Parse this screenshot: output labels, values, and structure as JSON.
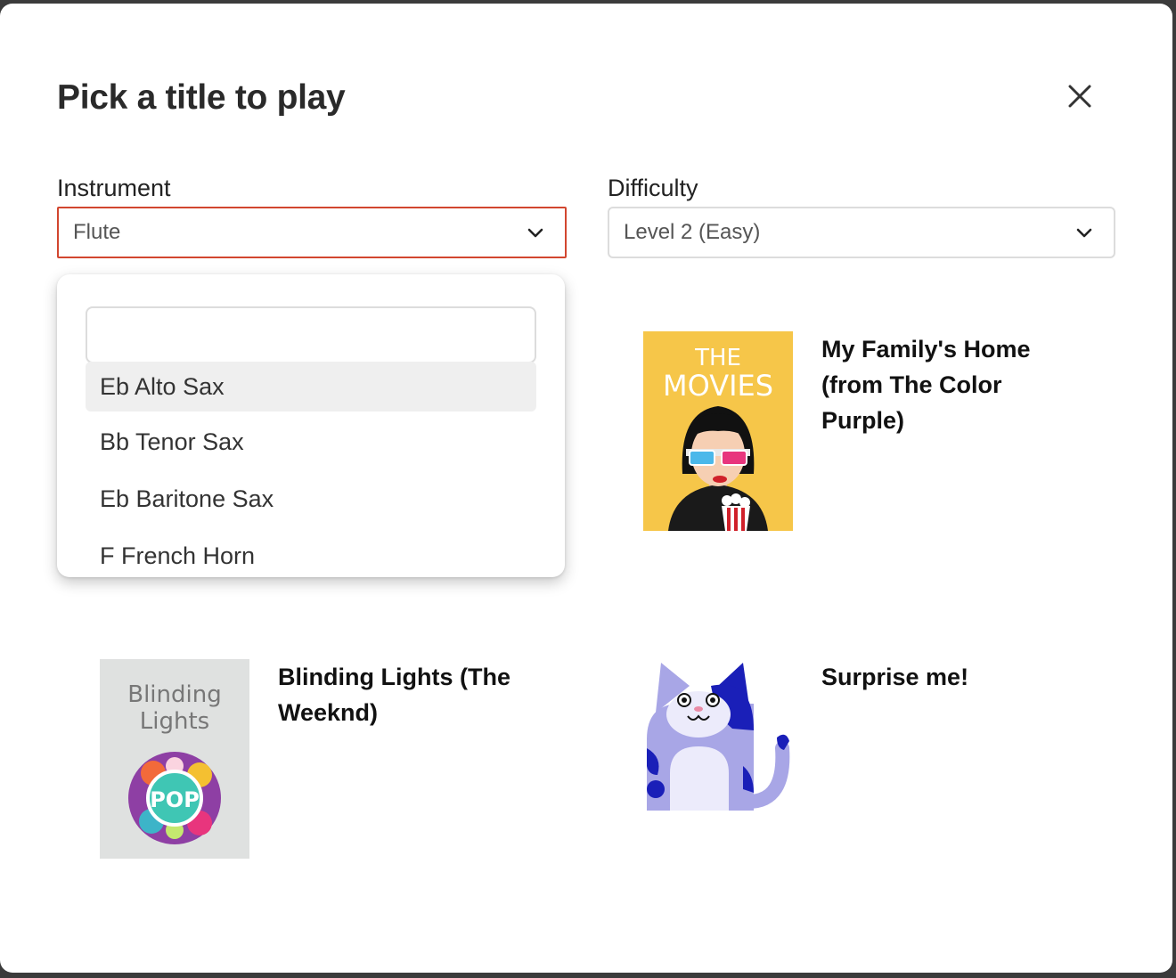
{
  "dialog": {
    "title": "Pick a title to play",
    "close_icon": "close-icon"
  },
  "filters": {
    "instrument": {
      "label": "Instrument",
      "value": "Flute"
    },
    "difficulty": {
      "label": "Difficulty",
      "value": "Level 2 (Easy)"
    }
  },
  "dropdown": {
    "search_value": "",
    "items": [
      {
        "label": "Eb Alto Sax",
        "highlighted": true
      },
      {
        "label": "Bb Tenor Sax"
      },
      {
        "label": "Eb Baritone Sax"
      },
      {
        "label": "F French Horn"
      }
    ]
  },
  "cards": [
    {
      "title": "My Family's Home (from The Color Purple)",
      "cover_text": [
        "THE",
        "MOVIES"
      ]
    },
    {
      "title": "Blinding Lights (The Weeknd)",
      "cover_text": [
        "Blinding",
        "Lights",
        "POP"
      ]
    },
    {
      "title": "Surprise me!",
      "cover_icon": "cat-mascot-icon"
    }
  ],
  "colors": {
    "accent_border": "#d2462f",
    "movies_bg": "#f6c649",
    "cat_light": "#a8a6e6",
    "cat_dark": "#1a1fb8"
  }
}
